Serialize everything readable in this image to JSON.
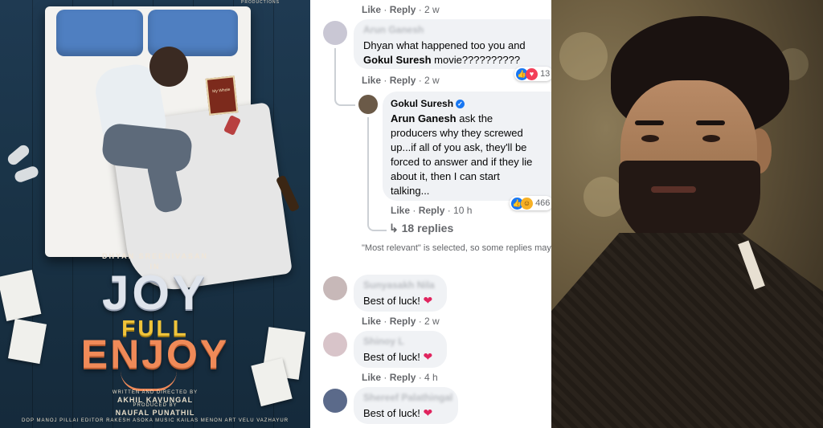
{
  "poster": {
    "studio": "PRODUCTIONS",
    "actor_credit": "DHYAN SREENIVASAN",
    "actor_in": "IN",
    "title_line1": "JOY",
    "title_line2": "FULL",
    "title_line3": "ENJOY",
    "direct_label": "WRITTEN AND DIRECTED BY",
    "director": "AKHIL KAVUNGAL",
    "produce_label": "PRODUCED BY",
    "producer": "NAUFAL PUNATHIL",
    "crew_line": "DOP MANOJ PILLAI   EDITOR RAKESH ASOKA   MUSIC KAILAS MENON   ART VELU VAZHAYUR",
    "book_title": "My Whole"
  },
  "comments": {
    "top_row": {
      "like": "Like",
      "reply": "Reply",
      "time": "2 w"
    },
    "c1": {
      "author": "Arun Ganesh",
      "text": "Dhyan what happened too you and ",
      "text_bold": "Gokul Suresh",
      "text_tail": " movie??????????",
      "like": "Like",
      "reply": "Reply",
      "time": "2 w",
      "reaction_count": "13"
    },
    "c2": {
      "author": "Gokul Suresh",
      "mention": "Arun Ganesh",
      "text": " ask the producers why they screwed up...if all of you ask, they'll be forced to answer and if they lie about it, then I can start talking...",
      "like": "Like",
      "reply": "Reply",
      "time": "10 h",
      "reaction_count": "466"
    },
    "replies_link": "18 replies",
    "relevance_note": "\"Most relevant\" is selected, so some replies may have been filtered out.",
    "c3": {
      "author": "Sunyasakh Nila",
      "text": "Best of luck!",
      "like": "Like",
      "reply": "Reply",
      "time": "2 w"
    },
    "c4": {
      "author": "Shinoy L",
      "text": "Best of luck!",
      "like": "Like",
      "reply": "Reply",
      "time": "4 h"
    },
    "c5": {
      "author": "Shereef Palathingal",
      "text": "Best of luck!"
    }
  },
  "colors": {
    "fb_blue": "#1877f2",
    "meta_gray": "#65676b",
    "bubble_bg": "#f0f2f5"
  }
}
